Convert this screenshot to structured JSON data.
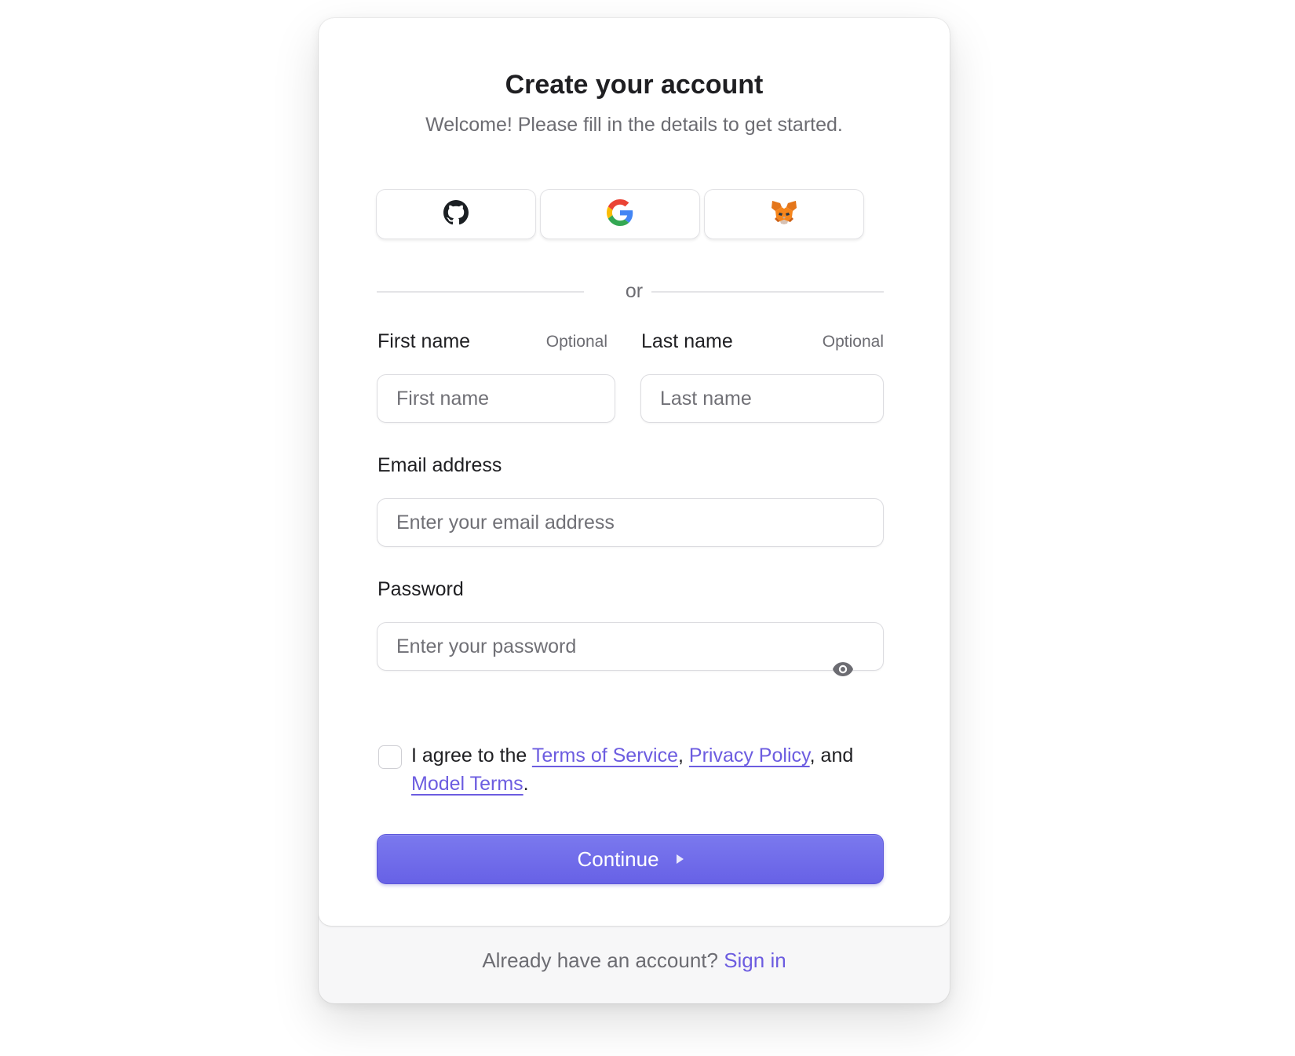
{
  "header": {
    "title": "Create your account",
    "subtitle": "Welcome! Please fill in the details to get started."
  },
  "social": {
    "providers": [
      {
        "icon": "github-icon"
      },
      {
        "icon": "google-icon"
      },
      {
        "icon": "metamask-fox-icon"
      }
    ]
  },
  "divider": {
    "text": "or"
  },
  "form": {
    "first_name": {
      "label": "First name",
      "optional": "Optional",
      "placeholder": "First name"
    },
    "last_name": {
      "label": "Last name",
      "optional": "Optional",
      "placeholder": "Last name"
    },
    "email": {
      "label": "Email address",
      "placeholder": "Enter your email address"
    },
    "password": {
      "label": "Password",
      "placeholder": "Enter your password",
      "toggle_icon": "eye-icon"
    }
  },
  "agreement": {
    "prefix": "I agree to the ",
    "terms_link": "Terms of Service",
    "comma1": ", ",
    "privacy_link": "Privacy Policy",
    "comma2": ", and ",
    "model_terms_link": "Model Terms",
    "period": "."
  },
  "continue_button": {
    "label": "Continue",
    "icon": "play-arrow-icon"
  },
  "footer": {
    "prompt": "Already have an account? ",
    "sign_in_link": "Sign in"
  },
  "colors": {
    "accent": "#6c5ce0",
    "button_top": "#7b79ee",
    "button_bottom": "#6761e6"
  }
}
